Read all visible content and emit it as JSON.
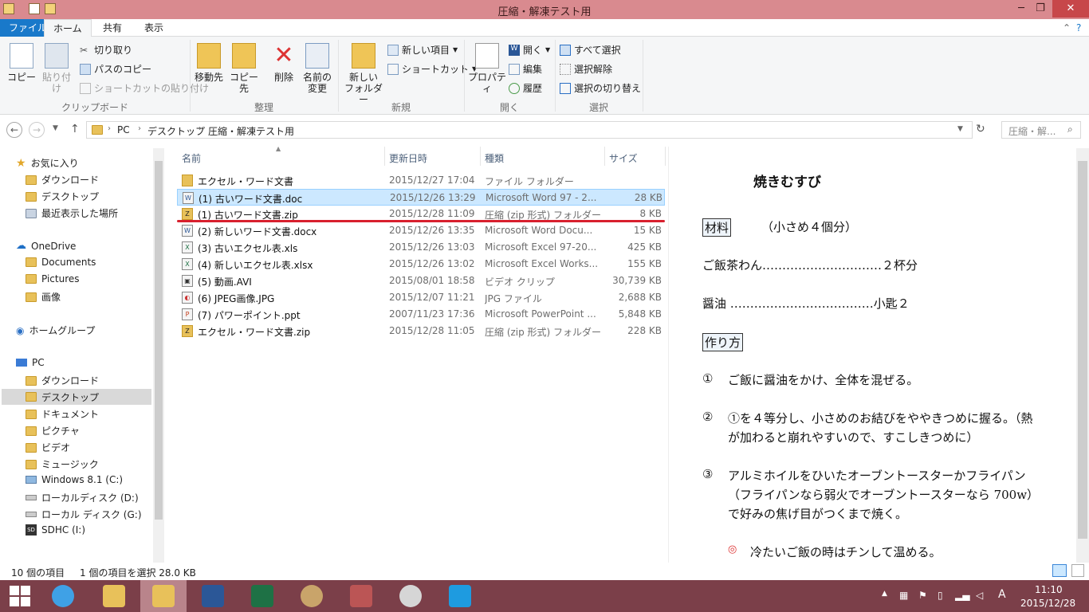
{
  "window": {
    "title": "圧縮・解凍テスト用",
    "minimize": "─",
    "maximize": "❐",
    "close": "✕"
  },
  "tabs": {
    "file": "ファイル",
    "home": "ホーム",
    "share": "共有",
    "view": "表示"
  },
  "ribbon": {
    "copy": "コピー",
    "paste": "貼り付け",
    "cut": "切り取り",
    "copy_path": "パスのコピー",
    "paste_shortcut": "ショートカットの貼り付け",
    "group_clipboard": "クリップボード",
    "move_to": "移動先",
    "copy_to": "コピー先",
    "delete": "削除",
    "rename_line1": "名前の",
    "rename_line2": "変更",
    "group_organize": "整理",
    "new_folder_line1": "新しい",
    "new_folder_line2": "フォルダー",
    "new_item": "新しい項目",
    "shortcut": "ショートカット",
    "group_new": "新規",
    "properties": "プロパティ",
    "open": "開く",
    "edit": "編集",
    "history": "履歴",
    "group_open": "開く",
    "select_all": "すべて選択",
    "select_none": "選択解除",
    "invert_selection": "選択の切り替え",
    "group_select": "選択"
  },
  "address": {
    "crumbs": [
      "PC",
      "デスクトップ",
      "圧縮・解凍テスト用"
    ],
    "search_placeholder": "圧縮・解..."
  },
  "nav": {
    "favorites": "お気に入り",
    "fav_items": [
      "ダウンロード",
      "デスクトップ",
      "最近表示した場所"
    ],
    "onedrive": "OneDrive",
    "od_items": [
      "Documents",
      "Pictures",
      "画像"
    ],
    "homegroup": "ホームグループ",
    "pc": "PC",
    "pc_items": [
      "ダウンロード",
      "デスクトップ",
      "ドキュメント",
      "ピクチャ",
      "ビデオ",
      "ミュージック"
    ],
    "drives": [
      "Windows 8.1 (C:)",
      "ローカルディスク (D:)",
      "ローカル ディスク (G:)",
      "SDHC (I:)"
    ]
  },
  "columns": {
    "name": "名前",
    "date": "更新日時",
    "type": "種類",
    "size": "サイズ"
  },
  "files": [
    {
      "name": "エクセル・ワード文書",
      "date": "2015/12/27 17:04",
      "type": "ファイル フォルダー",
      "size": "",
      "icon": "folder-icon"
    },
    {
      "name": "(1) 古いワード文書.doc",
      "date": "2015/12/26 13:29",
      "type": "Microsoft Word 97 - 2...",
      "size": "28 KB",
      "icon": "word-icon"
    },
    {
      "name": "(1) 古いワード文書.zip",
      "date": "2015/12/28 11:09",
      "type": "圧縮 (zip 形式) フォルダー",
      "size": "8 KB",
      "icon": "zip-icon"
    },
    {
      "name": "(2) 新しいワード文書.docx",
      "date": "2015/12/26 13:35",
      "type": "Microsoft Word Docu...",
      "size": "15 KB",
      "icon": "word-icon"
    },
    {
      "name": "(3) 古いエクセル表.xls",
      "date": "2015/12/26 13:03",
      "type": "Microsoft Excel 97-20...",
      "size": "425 KB",
      "icon": "excel-icon"
    },
    {
      "name": "(4) 新しいエクセル表.xlsx",
      "date": "2015/12/26 13:02",
      "type": "Microsoft Excel Works...",
      "size": "155 KB",
      "icon": "excel-icon"
    },
    {
      "name": "(5) 動画.AVI",
      "date": "2015/08/01 18:58",
      "type": "ビデオ クリップ",
      "size": "30,739 KB",
      "icon": "video-icon"
    },
    {
      "name": "(6)  JPEG画像.JPG",
      "date": "2015/12/07 11:21",
      "type": "JPG ファイル",
      "size": "2,688 KB",
      "icon": "image-icon"
    },
    {
      "name": "(7) パワーポイント.ppt",
      "date": "2007/11/23 17:36",
      "type": "Microsoft PowerPoint ...",
      "size": "5,848 KB",
      "icon": "powerpoint-icon"
    },
    {
      "name": "エクセル・ワード文書.zip",
      "date": "2015/12/28 11:05",
      "type": "圧縮 (zip 形式) フォルダー",
      "size": "228 KB",
      "icon": "zip-icon"
    }
  ],
  "preview": {
    "title": "焼きむすび",
    "ingredients_label": "材料",
    "ingredients_note": "（小さめ４個分）",
    "ing1": "ご飯茶わん…………………………２杯分",
    "ing2": "醤油 ………………………………小匙２",
    "method_label": "作り方",
    "step1_num": "①",
    "step1": "ご飯に醤油をかけ、全体を混ぜる。",
    "step2_num": "②",
    "step2_l1": "①を４等分し、小さめのお結びをややきつめに握る。（熱",
    "step2_l2": "が加わると崩れやすいので、すこしきつめに）",
    "step3_num": "③",
    "step3_l1": "アルミホイルをひいたオーブントースターかフライパン",
    "step3_l2": "（フライパンなら弱火でオーブントースターなら 700w）",
    "step3_l3": "で好みの焦げ目がつくまで焼く。",
    "tip": "冷たいご飯の時はチンして温める。"
  },
  "status": {
    "count": "10 個の項目",
    "selection": "1 個の項目を選択  28.0 KB"
  },
  "taskbar": {
    "time": "11:10",
    "date": "2015/12/28",
    "ime": "A"
  },
  "colors": {
    "accent": "#1979ca",
    "title_bar": "#d98a8f",
    "taskbar": "#7b3f49",
    "selection": "#cce8ff",
    "underline": "#d8202e"
  }
}
